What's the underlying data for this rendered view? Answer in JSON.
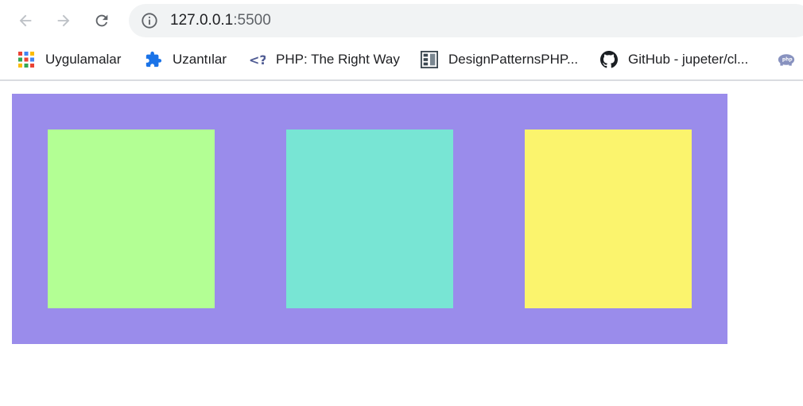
{
  "browser": {
    "url_host": "127.0.0.1",
    "url_port": ":5500",
    "bookmarks": [
      {
        "label": "Uygulamalar",
        "icon": "apps-grid-icon"
      },
      {
        "label": "Uzantılar",
        "icon": "puzzle-extension-icon"
      },
      {
        "label": "PHP: The Right Way",
        "icon": "php-right-way-icon"
      },
      {
        "label": "DesignPatternsPHP...",
        "icon": "design-patterns-icon"
      },
      {
        "label": "GitHub - jupeter/cl...",
        "icon": "github-icon"
      },
      {
        "label": "",
        "icon": "php-elephant-icon"
      }
    ]
  },
  "page": {
    "container_color": "#9a8ceb",
    "boxes": [
      {
        "color": "#b3ff94"
      },
      {
        "color": "#78e5d4"
      },
      {
        "color": "#fbf46d"
      }
    ]
  }
}
